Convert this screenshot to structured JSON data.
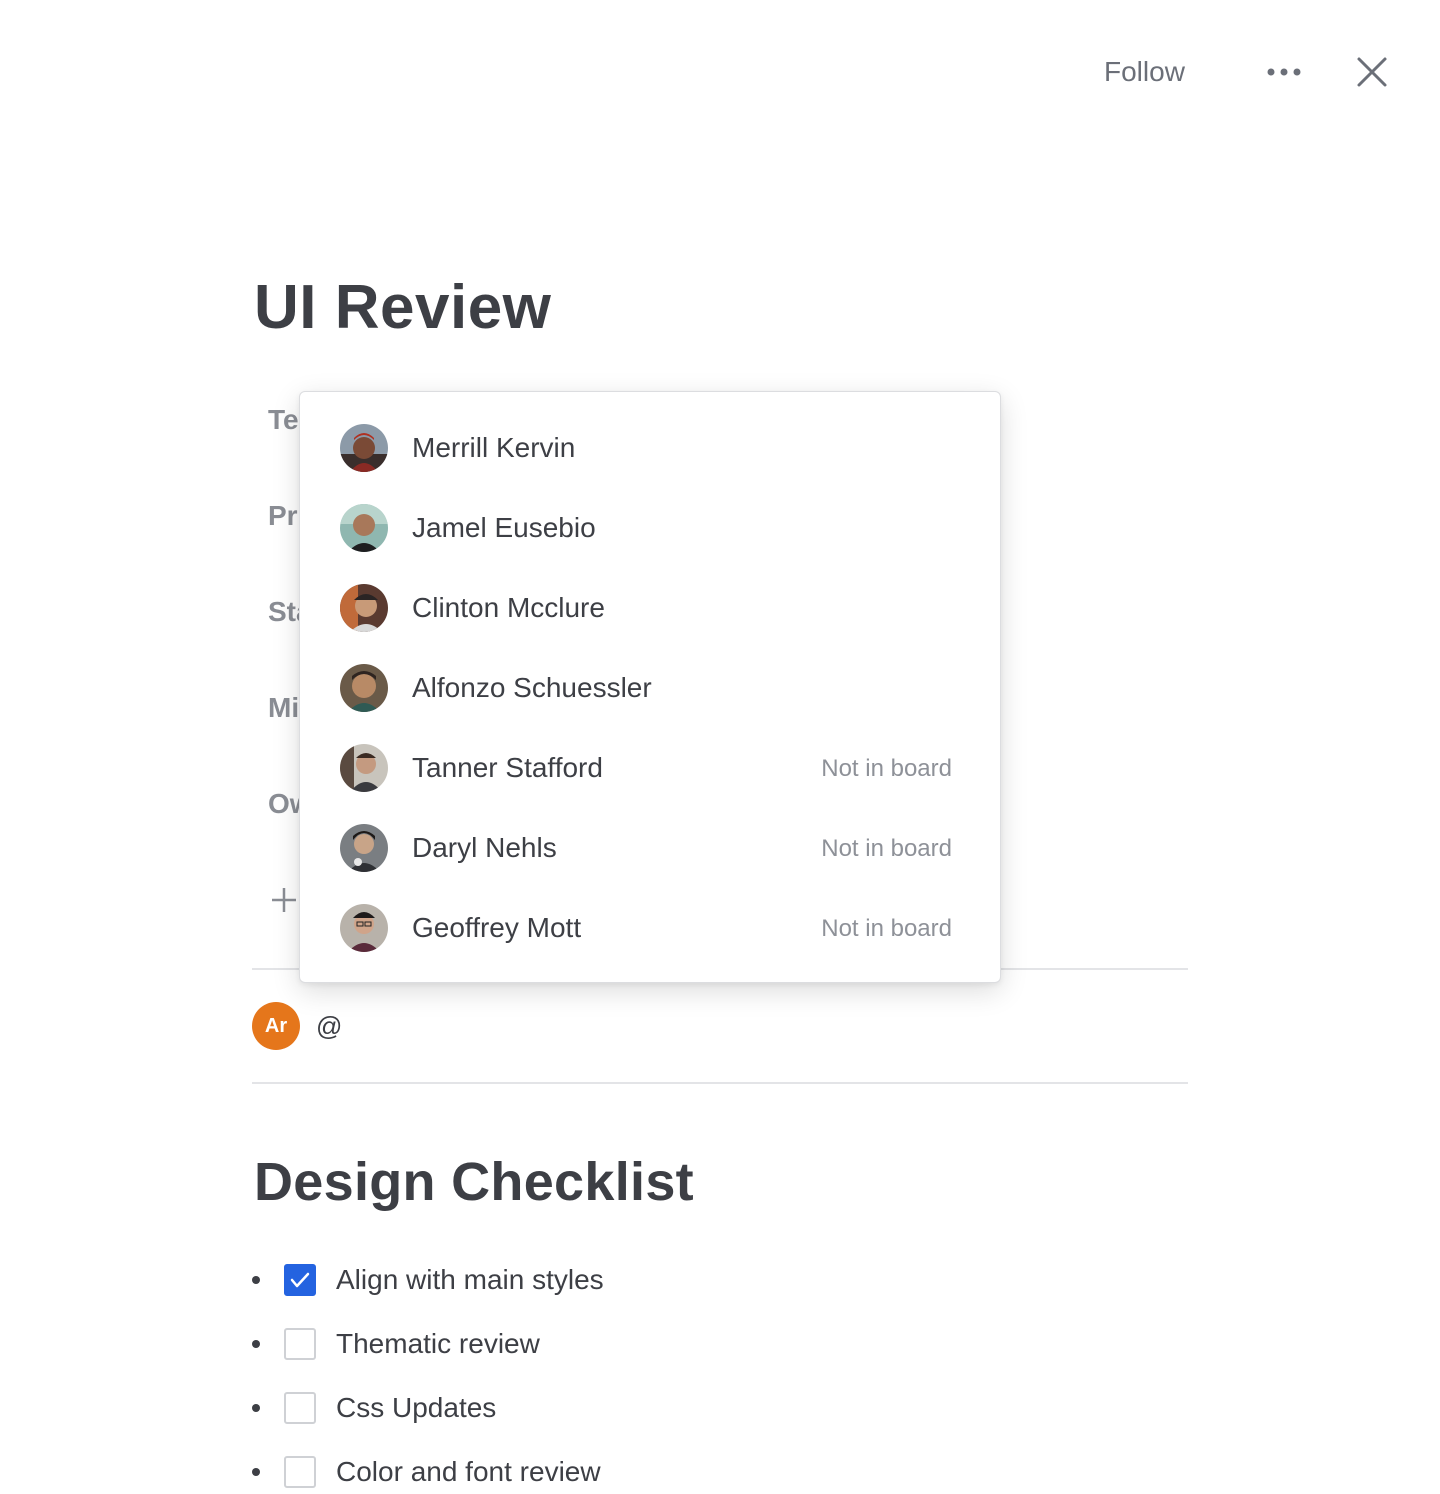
{
  "topbar": {
    "follow_label": "Follow"
  },
  "page": {
    "title": "UI Review"
  },
  "properties": {
    "labels": [
      "Te",
      "Pr",
      "Sta",
      "Mi",
      "Ow"
    ]
  },
  "mention_dropdown": {
    "items": [
      {
        "name": "Merrill Kervin",
        "status": ""
      },
      {
        "name": "Jamel Eusebio",
        "status": ""
      },
      {
        "name": "Clinton Mcclure",
        "status": ""
      },
      {
        "name": "Alfonzo Schuessler",
        "status": ""
      },
      {
        "name": "Tanner Stafford",
        "status": "Not in board"
      },
      {
        "name": "Daryl Nehls",
        "status": "Not in board"
      },
      {
        "name": "Geoffrey Mott",
        "status": "Not in board"
      }
    ]
  },
  "comment": {
    "avatar_initials": "Ar",
    "avatar_color": "#e5761b",
    "input_value": "@"
  },
  "checklist": {
    "title": "Design Checklist",
    "items": [
      {
        "label": "Align with main styles",
        "checked": true
      },
      {
        "label": "Thematic review",
        "checked": false
      },
      {
        "label": "Css Updates",
        "checked": false
      },
      {
        "label": "Color and font review",
        "checked": false
      }
    ]
  },
  "colors": {
    "accent": "#2463e0",
    "text": "#3d3f45",
    "muted": "#8e9198"
  }
}
